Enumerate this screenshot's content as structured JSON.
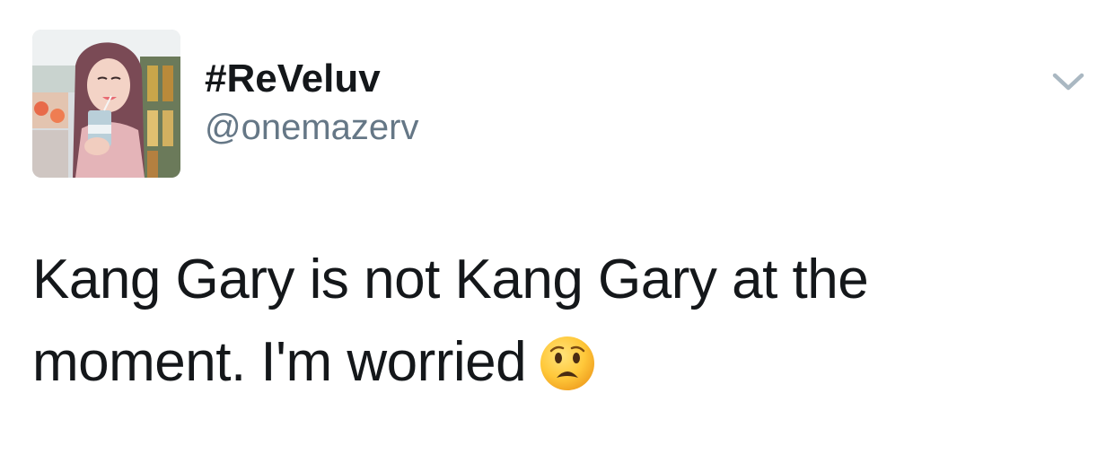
{
  "tweet": {
    "display_name": "#ReVeluv",
    "handle": "@onemazerv",
    "text_line1": "Kang Gary is not Kang Gary at the",
    "text_line2": "moment. I'm worried",
    "emoji": "frowning-face-open-mouth-emoji",
    "menu_icon": "chevron-down-icon"
  },
  "colors": {
    "text": "#14171a",
    "handle": "#657786",
    "caret": "#aab8c2"
  }
}
